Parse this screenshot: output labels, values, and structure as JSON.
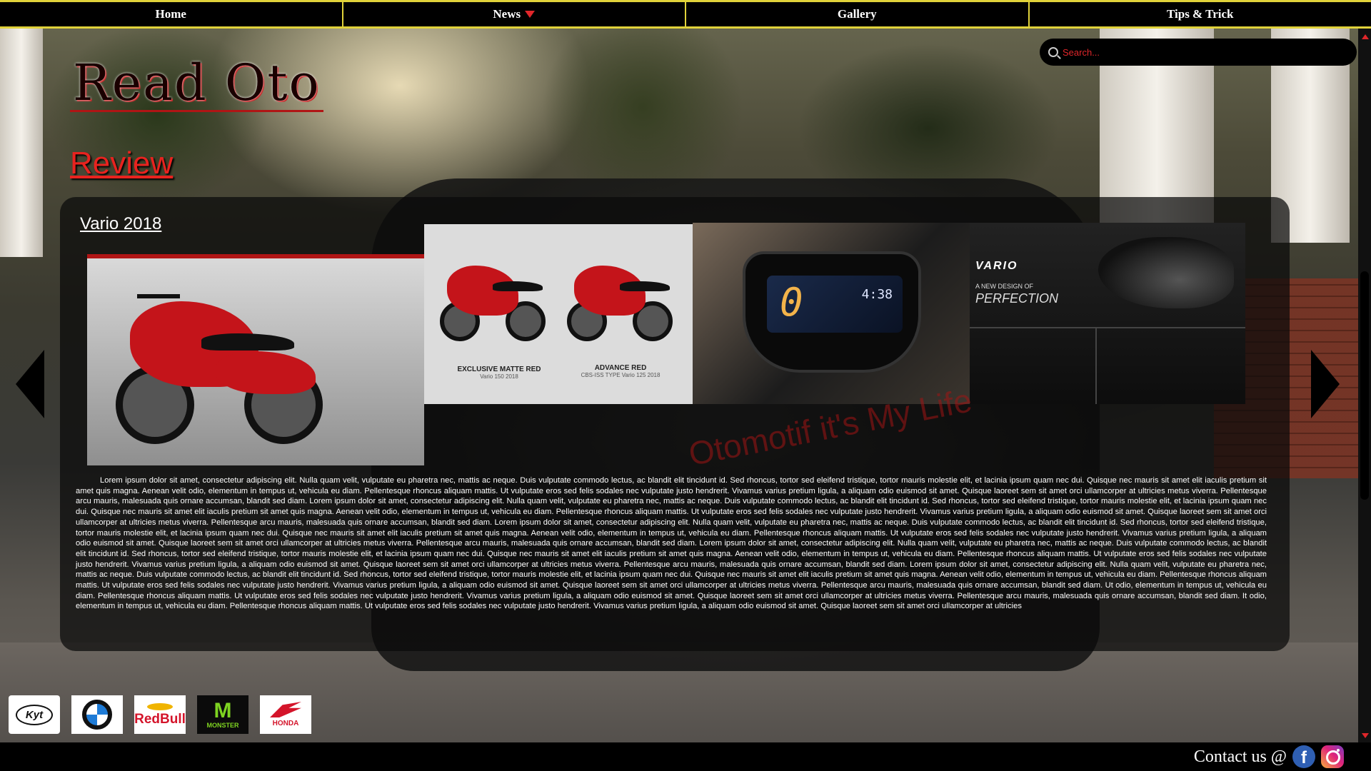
{
  "nav": {
    "home": "Home",
    "news": "News",
    "gallery": "Gallery",
    "tips": "Tips & Trick"
  },
  "search": {
    "placeholder": "Search..."
  },
  "site": {
    "logo": "Read Oto"
  },
  "section": {
    "title": "Review"
  },
  "article": {
    "title": "Vario 2018",
    "watermark": "Otomotif it's My Life",
    "body": "Lorem ipsum dolor sit amet, consectetur adipiscing elit. Nulla quam velit, vulputate eu pharetra nec, mattis ac neque. Duis vulputate commodo lectus, ac blandit elit tincidunt id. Sed rhoncus, tortor sed eleifend tristique, tortor mauris molestie elit, et lacinia ipsum quam nec dui. Quisque nec mauris sit amet elit iaculis pretium sit amet quis magna. Aenean velit odio, elementum in tempus ut, vehicula eu diam. Pellentesque rhoncus aliquam mattis. Ut vulputate eros sed felis sodales nec vulputate justo hendrerit. Vivamus varius pretium ligula, a aliquam odio euismod sit amet. Quisque laoreet sem sit amet orci ullamcorper at ultricies metus viverra. Pellentesque arcu mauris, malesuada quis ornare accumsan, blandit sed diam. Lorem ipsum dolor sit amet, consectetur adipiscing elit. Nulla quam velit, vulputate eu pharetra nec, mattis ac neque. Duis vulputate commodo lectus, ac blandit elit tincidunt id. Sed rhoncus, tortor sed eleifend tristique, tortor mauris molestie elit, et lacinia ipsum quam nec dui. Quisque nec mauris sit amet elit iaculis pretium sit amet quis magna. Aenean velit odio, elementum in tempus ut, vehicula eu diam. Pellentesque rhoncus aliquam mattis. Ut vulputate eros sed felis sodales nec vulputate justo hendrerit. Vivamus varius pretium ligula, a aliquam odio euismod sit amet. Quisque laoreet sem sit amet orci ullamcorper at ultricies metus viverra. Pellentesque arcu mauris, malesuada quis ornare accumsan, blandit sed diam. Lorem ipsum dolor sit amet, consectetur adipiscing elit. Nulla quam velit, vulputate eu pharetra nec, mattis ac neque. Duis vulputate commodo lectus, ac blandit elit tincidunt id. Sed rhoncus, tortor sed eleifend tristique, tortor mauris molestie elit, et lacinia ipsum quam nec dui. Quisque nec mauris sit amet elit iaculis pretium sit amet quis magna. Aenean velit odio, elementum in tempus ut, vehicula eu diam. Pellentesque rhoncus aliquam mattis. Ut vulputate eros sed felis sodales nec vulputate justo hendrerit. Vivamus varius pretium ligula, a aliquam odio euismod sit amet. Quisque laoreet sem sit amet orci ullamcorper at ultricies metus viverra. Pellentesque arcu mauris, malesuada quis ornare accumsan, blandit sed diam. Lorem ipsum dolor sit amet, consectetur adipiscing elit. Nulla quam velit, vulputate eu pharetra nec, mattis ac neque. Duis vulputate commodo lectus, ac blandit elit tincidunt id. Sed rhoncus, tortor sed eleifend tristique, tortor mauris molestie elit, et lacinia ipsum quam nec dui. Quisque nec mauris sit amet elit iaculis pretium sit amet quis magna. Aenean velit odio, elementum in tempus ut, vehicula eu diam. Pellentesque rhoncus aliquam mattis. Ut vulputate eros sed felis sodales nec vulputate justo hendrerit. Vivamus varius pretium ligula, a aliquam odio euismod sit amet. Quisque laoreet sem sit amet orci ullamcorper at ultricies metus viverra. Pellentesque arcu mauris, malesuada quis ornare accumsan, blandit sed diam. Lorem ipsum dolor sit amet, consectetur adipiscing elit. Nulla quam velit, vulputate eu pharetra nec, mattis ac neque. Duis vulputate commodo lectus, ac blandit elit tincidunt id. Sed rhoncus, tortor sed eleifend tristique, tortor mauris molestie elit, et lacinia ipsum quam nec dui. Quisque nec mauris sit amet elit iaculis pretium sit amet quis magna. Aenean velit odio, elementum in tempus ut, vehicula eu diam. Pellentesque rhoncus aliquam mattis. Ut vulputate eros sed felis sodales nec vulputate justo hendrerit. Vivamus varius pretium ligula, a aliquam odio euismod sit amet. Quisque laoreet sem sit amet orci ullamcorper at ultricies metus viverra. Pellentesque arcu mauris, malesuada quis ornare accumsan, blandit sed diam. Ut odio, elementum in tempus ut, vehicula eu diam. Pellentesque rhoncus aliquam mattis. Ut vulputate eros sed felis sodales nec vulputate justo hendrerit. Vivamus varius pretium ligula, a aliquam odio euismod sit amet. Quisque laoreet sem sit amet orci ullamcorper at ultricies metus viverra. Pellentesque arcu mauris, malesuada quis ornare accumsan, blandit sed diam. It odio, elementum in tempus ut, vehicula eu diam. Pellentesque rhoncus aliquam mattis. Ut vulputate eros sed felis sodales nec vulputate justo hendrerit. Vivamus varius pretium ligula, a aliquam odio euismod sit amet. Quisque laoreet sem sit amet orci ullamcorper at ultricies"
  },
  "gallery": {
    "slide2_caption_left": "EXCLUSIVE MATTE RED",
    "slide2_sub_left": "Vario 150 2018",
    "slide2_caption_right": "ADVANCE RED",
    "slide2_sub_right": "CBS-ISS TYPE Vario 125 2018",
    "slide3_speed": "0",
    "slide3_time": "4:38",
    "slide4_logo": "VARIO",
    "slide4_tag": "A NEW DESIGN OF",
    "slide4_word": "PERFECTION"
  },
  "sponsors": [
    {
      "name": "kyt",
      "text": "Kyt"
    },
    {
      "name": "bmw",
      "text": ""
    },
    {
      "name": "redbull",
      "text": "RedBull"
    },
    {
      "name": "monster",
      "text": "MONSTER"
    },
    {
      "name": "honda",
      "text": "HONDA"
    }
  ],
  "footer": {
    "contact": "Contact us @"
  },
  "icons": {
    "search": "search-icon",
    "news_caret": "caret-down-icon",
    "prev": "arrow-left-icon",
    "next": "arrow-right-icon",
    "facebook": "facebook-icon",
    "instagram": "instagram-icon"
  },
  "colors": {
    "accent_red": "#e0262a",
    "nav_border": "#e0d23a"
  }
}
